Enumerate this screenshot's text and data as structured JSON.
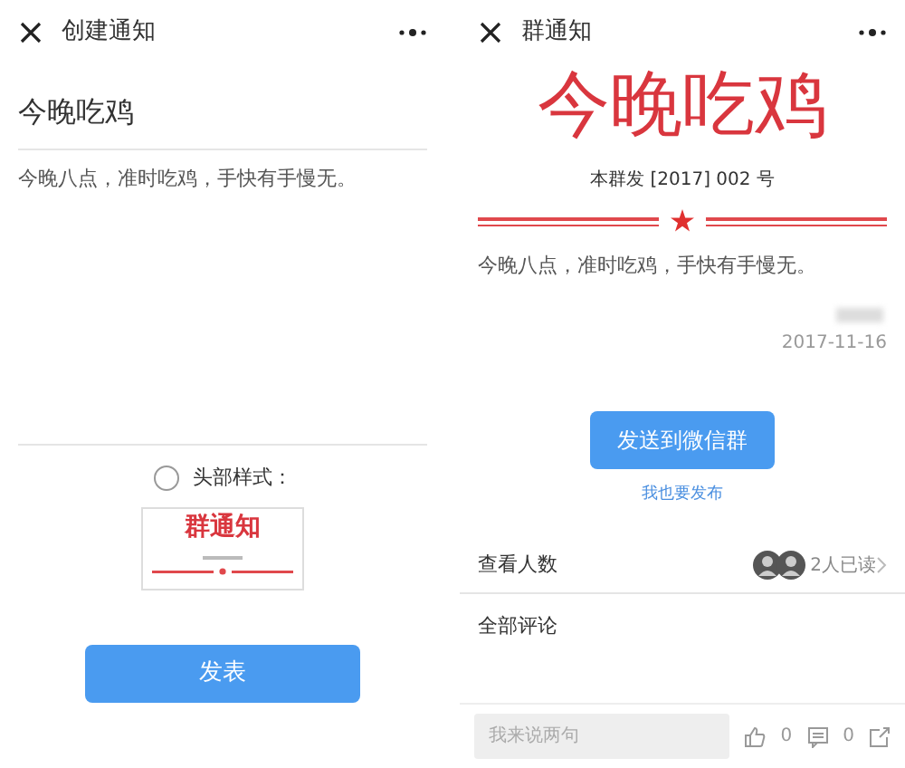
{
  "create_screen": {
    "title": "创建通知",
    "notice_title": "今晚吃鸡",
    "notice_body": "今晚八点，准时吃鸡，手快有手慢无。",
    "header_style": {
      "label": "头部样式：",
      "checked": false
    },
    "preview_title": "群通知",
    "submit_button": "发表"
  },
  "notice_screen": {
    "title": "群通知",
    "headline": "今晚吃鸡",
    "doc_number": "本群发 [2017] 002 号",
    "body": "今晚八点，准时吃鸡，手快有手慢无。",
    "date": "2017-11-16",
    "send_button": "发送到微信群",
    "publish_link": "我也要发布",
    "viewers": {
      "label": "查看人数",
      "count": "2人已读"
    },
    "comments_label": "全部评论",
    "comment_input": {
      "placeholder": "我来说两句"
    },
    "likes": "0",
    "comments": "0"
  }
}
